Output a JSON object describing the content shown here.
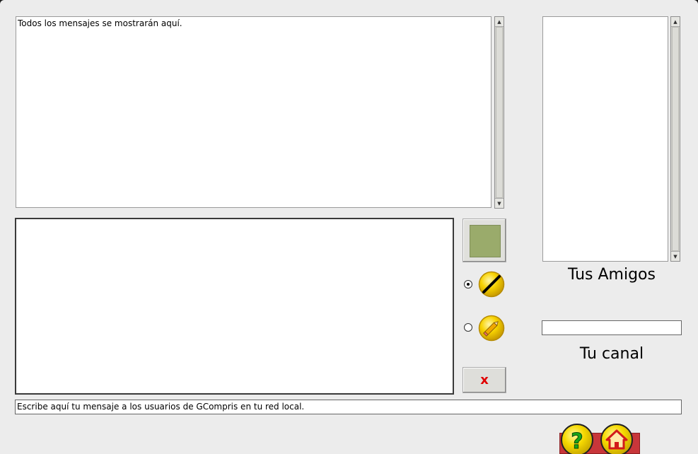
{
  "messages": {
    "placeholder_text": "Todos los mensajes se mostrarán aquí."
  },
  "friends": {
    "label": "Tus Amigos",
    "items": []
  },
  "channel": {
    "label": "Tu canal",
    "value": ""
  },
  "compose": {
    "text": "Escribe aquí tu mensaje a los usuarios de GCompris en tu red local."
  },
  "tools": {
    "selected_color": "#9aab6b",
    "line_tool_selected": true,
    "pencil_tool_selected": false,
    "clear_label": "x"
  },
  "icons": {
    "help": "question-icon",
    "home": "home-icon",
    "line": "line-tool-icon",
    "pencil": "pencil-icon"
  }
}
